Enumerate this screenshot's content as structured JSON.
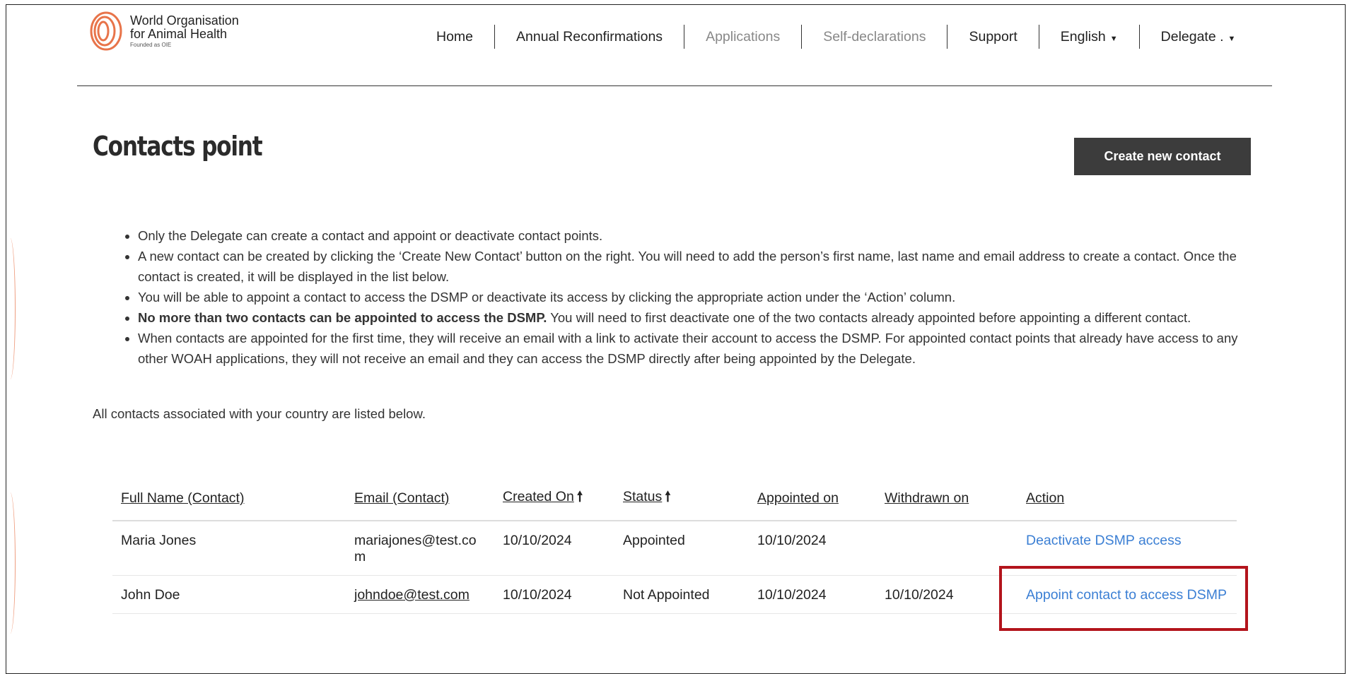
{
  "header": {
    "logo": {
      "line1": "World Organisation",
      "line2": "for Animal Health",
      "line3": "Founded as OIE",
      "color": "#e8744a"
    },
    "nav": [
      {
        "label": "Home",
        "muted": false
      },
      {
        "label": "Annual Reconfirmations",
        "muted": false
      },
      {
        "label": "Applications",
        "muted": true
      },
      {
        "label": "Self-declarations",
        "muted": true
      },
      {
        "label": "Support",
        "muted": false
      },
      {
        "label": "English",
        "muted": false,
        "dropdown": true
      },
      {
        "label": "Delegate .",
        "muted": false,
        "dropdown": true
      }
    ]
  },
  "page": {
    "title": "Contacts point",
    "create_button": "Create new contact"
  },
  "info": [
    {
      "bold": "",
      "text": "Only the Delegate can create a contact and appoint or deactivate contact points."
    },
    {
      "bold": "",
      "text": "A new contact can be created by clicking the ‘Create New Contact’ button on the right. You will need to add the person’s first name, last name and email address to create a contact. Once the contact is created, it will be displayed in the list below."
    },
    {
      "bold": "",
      "text": "You will be able to appoint a contact to access the DSMP or deactivate its access by clicking the appropriate action under the ‘Action’ column."
    },
    {
      "bold": "No more than two contacts can be appointed to access the DSMP.",
      "text": " You will need to first deactivate one of the two contacts already appointed before appointing a different contact."
    },
    {
      "bold": "",
      "text": "When contacts are appointed for the first time, they will receive an email with a link to activate their account to access the DSMP. For appointed contact points that already have access to any other WOAH applications, they will not receive an email and they can access the DSMP directly after being appointed by the Delegate."
    }
  ],
  "intro": "All contacts associated with your country are listed below.",
  "table": {
    "headers": {
      "full_name": "Full Name (Contact)",
      "email": "Email (Contact)",
      "created_on": "Created On",
      "status": "Status",
      "appointed_on": "Appointed on",
      "withdrawn_on": "Withdrawn on",
      "action": "Action"
    },
    "sort_arrow": "🠕",
    "rows": [
      {
        "name": "Maria Jones",
        "email": "mariajones@test.com",
        "created": "10/10/2024",
        "status": "Appointed",
        "status_kind": "appointed",
        "appointed": "10/10/2024",
        "withdrawn": "",
        "action": "Deactivate DSMP access"
      },
      {
        "name": "John Doe",
        "email": "johndoe@test.com",
        "created": "10/10/2024",
        "status": "Not Appointed",
        "status_kind": "not",
        "appointed": "10/10/2024",
        "withdrawn": "10/10/2024",
        "action": "Appoint contact to access DSMP"
      }
    ]
  },
  "colors": {
    "appointed": "#3dbb3d",
    "not_appointed": "#e3231e",
    "link": "#3b7fd4",
    "highlight": "#b3141c"
  }
}
